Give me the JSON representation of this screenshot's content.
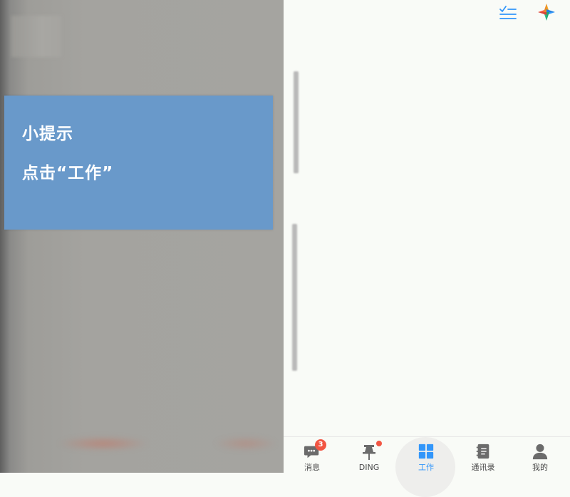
{
  "hint": {
    "title": "小提示",
    "body": "点击“工作”"
  },
  "top_icons": [
    "checklist-icon",
    "app-logo-icon"
  ],
  "bottom_nav": {
    "items": [
      {
        "label": "消息",
        "icon": "message-icon",
        "badge": "3"
      },
      {
        "label": "DING",
        "icon": "ding-pin-icon",
        "badge_dot": true
      },
      {
        "label": "工作",
        "icon": "work-grid-icon",
        "active": true
      },
      {
        "label": "通讯录",
        "icon": "contacts-book-icon"
      },
      {
        "label": "我的",
        "icon": "profile-icon"
      }
    ]
  },
  "colors": {
    "accent": "#3296fa",
    "hint_card": "#6999ca",
    "badge": "#f25643",
    "overlay": "#a5a4a0"
  }
}
